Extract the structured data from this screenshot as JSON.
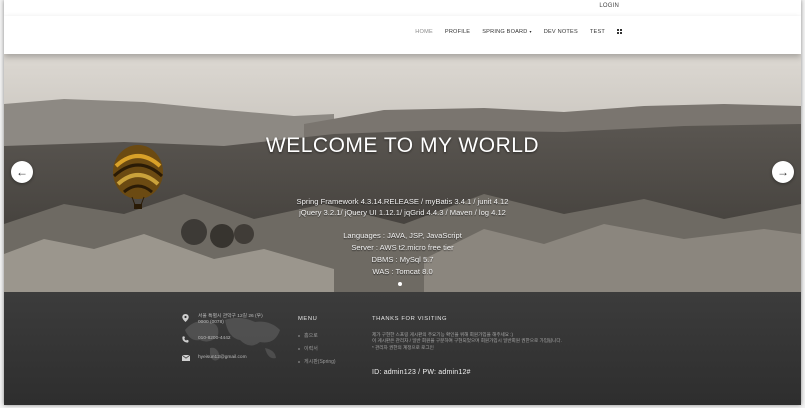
{
  "topbar": {
    "login_label": "LOGIN"
  },
  "nav": {
    "items": [
      {
        "label": "HOME"
      },
      {
        "label": "PROFILE"
      },
      {
        "label": "SPRING BOARD"
      },
      {
        "label": "DEV NOTES"
      },
      {
        "label": "TEST"
      }
    ],
    "dropdown_caret": "▾"
  },
  "hero": {
    "subtitle": "",
    "title": "WELCOME TO MY WORLD",
    "lines": [
      "Spring Framework 4.3.14.RELEASE / myBatis 3.4.1 / junit 4.12",
      "jQuery 3.2.1/ jQuery UI 1.12.1/ jqGrid 4.4.3 / Maven / log 4.12",
      "Languages : JAVA, JSP, JavaScript",
      "Server : AWS t2.micro free tier",
      "DBMS : MySql 5.7",
      "WAS : Tomcat 8.0"
    ],
    "prev_symbol": "←",
    "next_symbol": "→",
    "accent": "#ffffff"
  },
  "footer": {
    "address": "서울 특별시 관악구 12길 26 (우) 0000 (0078)",
    "phone": "010-8200-4442",
    "email": "hyeisun12@gmail.com",
    "menu_heading": "MENU",
    "menu_items": [
      "홈으로",
      "이력서",
      "게시판(Spring)"
    ],
    "thanks_heading": "THANKS FOR VISITING",
    "thanks_lines": [
      "제가 구현한 스프링 게시판의 주요기능 확인을 위해 회원가입을 해주세요 :)",
      "이 게시판은 관리자 / 일반 회원을 구분하여 구현되었으며 회원가입시 일반회원 권한으로 가입됩니다.",
      "* 관리자 권한의 계정으로 로그인"
    ],
    "credentials": "ID: admin123 / PW: admin12#"
  }
}
